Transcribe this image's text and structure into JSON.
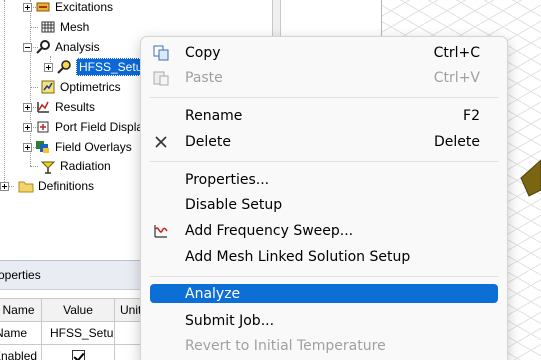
{
  "tree": {
    "items": [
      {
        "label": "Excitations",
        "icon": "excitations-icon"
      },
      {
        "label": "Mesh",
        "icon": "mesh-icon"
      },
      {
        "label": "Analysis",
        "icon": "analysis-icon"
      },
      {
        "label": "HFSS_Setup",
        "icon": "setup-icon",
        "selected": true
      },
      {
        "label": "Optimetrics",
        "icon": "optimetrics-icon"
      },
      {
        "label": "Results",
        "icon": "results-icon"
      },
      {
        "label": "Port Field Display",
        "icon": "port-field-icon"
      },
      {
        "label": "Field Overlays",
        "icon": "field-overlays-icon"
      },
      {
        "label": "Radiation",
        "icon": "radiation-icon"
      },
      {
        "label": "Definitions",
        "icon": "folder-icon"
      }
    ]
  },
  "properties": {
    "title": "Properties",
    "columns": [
      "Name",
      "Value",
      "Unit"
    ],
    "rows": [
      {
        "name": "Name",
        "value": "HFSS_Setup"
      },
      {
        "name": "Enabled",
        "value": "",
        "checked": true
      }
    ]
  },
  "context_menu": {
    "items": [
      {
        "label": "Copy",
        "shortcut": "Ctrl+C",
        "icon": "copy-icon",
        "enabled": true
      },
      {
        "label": "Paste",
        "shortcut": "Ctrl+V",
        "icon": "paste-icon",
        "enabled": false
      },
      {
        "label": "Rename",
        "shortcut": "F2",
        "enabled": true
      },
      {
        "label": "Delete",
        "shortcut": "Delete",
        "icon": "close-icon",
        "enabled": true
      },
      {
        "label": "Properties...",
        "enabled": true
      },
      {
        "label": "Disable Setup",
        "enabled": true
      },
      {
        "label": "Add Frequency Sweep...",
        "icon": "frequency-sweep-icon",
        "enabled": true
      },
      {
        "label": "Add Mesh Linked Solution Setup",
        "enabled": true
      },
      {
        "label": "Analyze",
        "enabled": true,
        "highlighted": true
      },
      {
        "label": "Submit Job...",
        "enabled": true
      },
      {
        "label": "Revert to Initial Temperature",
        "enabled": false
      }
    ]
  },
  "colors": {
    "selection": "#0b68d4",
    "menu_highlight": "#0b6fd5",
    "model_geometry": "#7a6512"
  }
}
